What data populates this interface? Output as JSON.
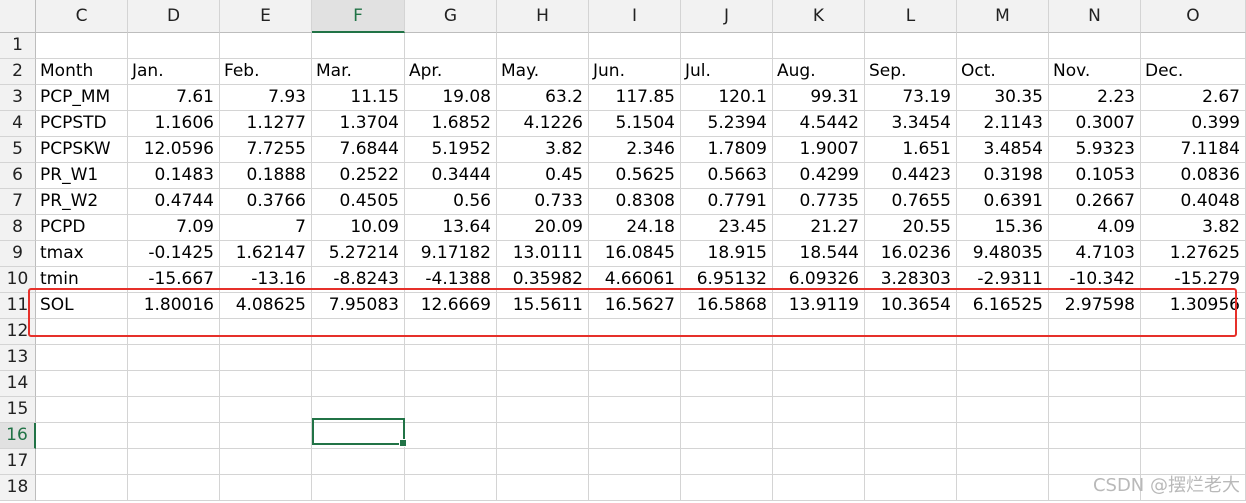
{
  "columns": [
    "C",
    "D",
    "E",
    "F",
    "G",
    "H",
    "I",
    "J",
    "K",
    "L",
    "M",
    "N",
    "O"
  ],
  "selected_column": "F",
  "rows": [
    {
      "num": "1",
      "cells": [
        "",
        "",
        "",
        "",
        "",
        "",
        "",
        "",
        "",
        "",
        "",
        "",
        ""
      ]
    },
    {
      "num": "2",
      "cells": [
        "Month",
        "Jan.",
        "Feb.",
        "Mar.",
        "Apr.",
        "May.",
        "Jun.",
        "Jul.",
        "Aug.",
        "Sep.",
        "Oct.",
        "Nov.",
        "Dec."
      ]
    },
    {
      "num": "3",
      "cells": [
        "PCP_MM",
        "7.61",
        "7.93",
        "11.15",
        "19.08",
        "63.2",
        "117.85",
        "120.1",
        "99.31",
        "73.19",
        "30.35",
        "2.23",
        "2.67"
      ]
    },
    {
      "num": "4",
      "cells": [
        "PCPSTD",
        "1.1606",
        "1.1277",
        "1.3704",
        "1.6852",
        "4.1226",
        "5.1504",
        "5.2394",
        "4.5442",
        "3.3454",
        "2.1143",
        "0.3007",
        "0.399"
      ]
    },
    {
      "num": "5",
      "cells": [
        "PCPSKW",
        "12.0596",
        "7.7255",
        "7.6844",
        "5.1952",
        "3.82",
        "2.346",
        "1.7809",
        "1.9007",
        "1.651",
        "3.4854",
        "5.9323",
        "7.1184"
      ]
    },
    {
      "num": "6",
      "cells": [
        "PR_W1",
        "0.1483",
        "0.1888",
        "0.2522",
        "0.3444",
        "0.45",
        "0.5625",
        "0.5663",
        "0.4299",
        "0.4423",
        "0.3198",
        "0.1053",
        "0.0836"
      ]
    },
    {
      "num": "7",
      "cells": [
        "PR_W2",
        "0.4744",
        "0.3766",
        "0.4505",
        "0.56",
        "0.733",
        "0.8308",
        "0.7791",
        "0.7735",
        "0.7655",
        "0.6391",
        "0.2667",
        "0.4048"
      ]
    },
    {
      "num": "8",
      "cells": [
        "PCPD",
        "7.09",
        "7",
        "10.09",
        "13.64",
        "20.09",
        "24.18",
        "23.45",
        "21.27",
        "20.55",
        "15.36",
        "4.09",
        "3.82"
      ]
    },
    {
      "num": "9",
      "cells": [
        "tmax",
        "-0.1425",
        "1.62147",
        "5.27214",
        "9.17182",
        "13.0111",
        "16.0845",
        "18.915",
        "18.544",
        "16.0236",
        "9.48035",
        "4.7103",
        "1.27625"
      ]
    },
    {
      "num": "10",
      "cells": [
        "tmin",
        "-15.667",
        "-13.16",
        "-8.8243",
        "-4.1388",
        "0.35982",
        "4.66061",
        "6.95132",
        "6.09326",
        "3.28303",
        "-2.9311",
        "-10.342",
        "-15.279"
      ]
    },
    {
      "num": "11",
      "cells": [
        "SOL",
        "1.80016",
        "4.08625",
        "7.95083",
        "12.6669",
        "15.5611",
        "16.5627",
        "16.5868",
        "13.9119",
        "10.3654",
        "6.16525",
        "2.97598",
        "1.30956"
      ]
    },
    {
      "num": "12",
      "cells": [
        "",
        "",
        "",
        "",
        "",
        "",
        "",
        "",
        "",
        "",
        "",
        "",
        ""
      ]
    },
    {
      "num": "13",
      "cells": [
        "",
        "",
        "",
        "",
        "",
        "",
        "",
        "",
        "",
        "",
        "",
        "",
        ""
      ]
    },
    {
      "num": "14",
      "cells": [
        "",
        "",
        "",
        "",
        "",
        "",
        "",
        "",
        "",
        "",
        "",
        "",
        ""
      ]
    },
    {
      "num": "15",
      "cells": [
        "",
        "",
        "",
        "",
        "",
        "",
        "",
        "",
        "",
        "",
        "",
        "",
        ""
      ]
    },
    {
      "num": "16",
      "cells": [
        "",
        "",
        "",
        "",
        "",
        "",
        "",
        "",
        "",
        "",
        "",
        "",
        ""
      ]
    },
    {
      "num": "17",
      "cells": [
        "",
        "",
        "",
        "",
        "",
        "",
        "",
        "",
        "",
        "",
        "",
        "",
        ""
      ]
    },
    {
      "num": "18",
      "cells": [
        "",
        "",
        "",
        "",
        "",
        "",
        "",
        "",
        "",
        "",
        "",
        "",
        ""
      ]
    }
  ],
  "selected_row": "16",
  "watermark": "CSDN @摆烂老大",
  "colors": {
    "highlight": "#e6302a",
    "active_cell": "#217346"
  }
}
